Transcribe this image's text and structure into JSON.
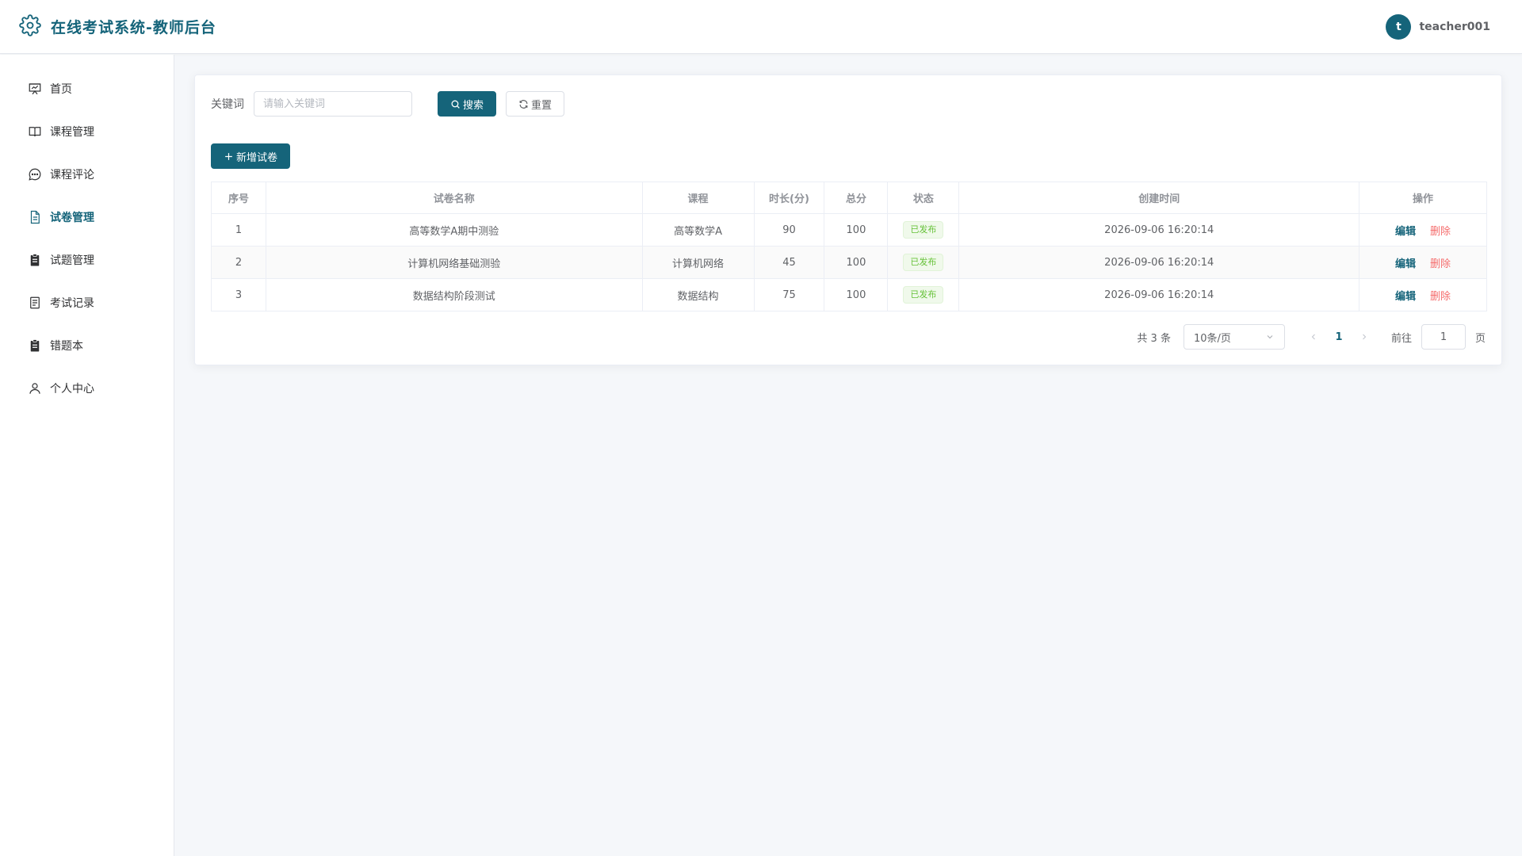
{
  "header": {
    "title": "在线考试系统-教师后台",
    "user": {
      "avatar_letter": "t",
      "username": "teacher001"
    }
  },
  "sidebar": {
    "items": [
      {
        "label": "首页",
        "icon": "dashboard-icon",
        "active": false
      },
      {
        "label": "课程管理",
        "icon": "book-icon",
        "active": false
      },
      {
        "label": "课程评论",
        "icon": "chat-icon",
        "active": false
      },
      {
        "label": "试卷管理",
        "icon": "document-icon",
        "active": true
      },
      {
        "label": "试题管理",
        "icon": "clipboard-icon",
        "active": false
      },
      {
        "label": "考试记录",
        "icon": "record-icon",
        "active": false
      },
      {
        "label": "错题本",
        "icon": "notebook-icon",
        "active": false
      },
      {
        "label": "个人中心",
        "icon": "user-icon",
        "active": false
      }
    ]
  },
  "search": {
    "keyword_label": "关键词",
    "keyword_placeholder": "请输入关键词",
    "keyword_value": "",
    "search_label": "搜索",
    "reset_label": "重置"
  },
  "toolbar": {
    "add_label": "新增试卷"
  },
  "table": {
    "columns": [
      "序号",
      "试卷名称",
      "课程",
      "时长(分)",
      "总分",
      "状态",
      "创建时间",
      "操作"
    ],
    "rows": [
      {
        "index": "1",
        "name": "高等数学A期中测验",
        "course": "高等数学A",
        "duration": "90",
        "score": "100",
        "status": "已发布",
        "created": "2026-09-06 16:20:14"
      },
      {
        "index": "2",
        "name": "计算机网络基础测验",
        "course": "计算机网络",
        "duration": "45",
        "score": "100",
        "status": "已发布",
        "created": "2026-09-06 16:20:14"
      },
      {
        "index": "3",
        "name": "数据结构阶段测试",
        "course": "数据结构",
        "duration": "75",
        "score": "100",
        "status": "已发布",
        "created": "2026-09-06 16:20:14"
      }
    ],
    "actions": {
      "edit": "编辑",
      "delete": "删除"
    }
  },
  "pagination": {
    "total_text": "共 3 条",
    "page_size": "10条/页",
    "current_page": "1",
    "goto_label": "前往",
    "goto_value": "1",
    "page_suffix": "页"
  },
  "colors": {
    "primary": "#15647a",
    "success": "#67c23a",
    "danger": "#f56c6c"
  }
}
